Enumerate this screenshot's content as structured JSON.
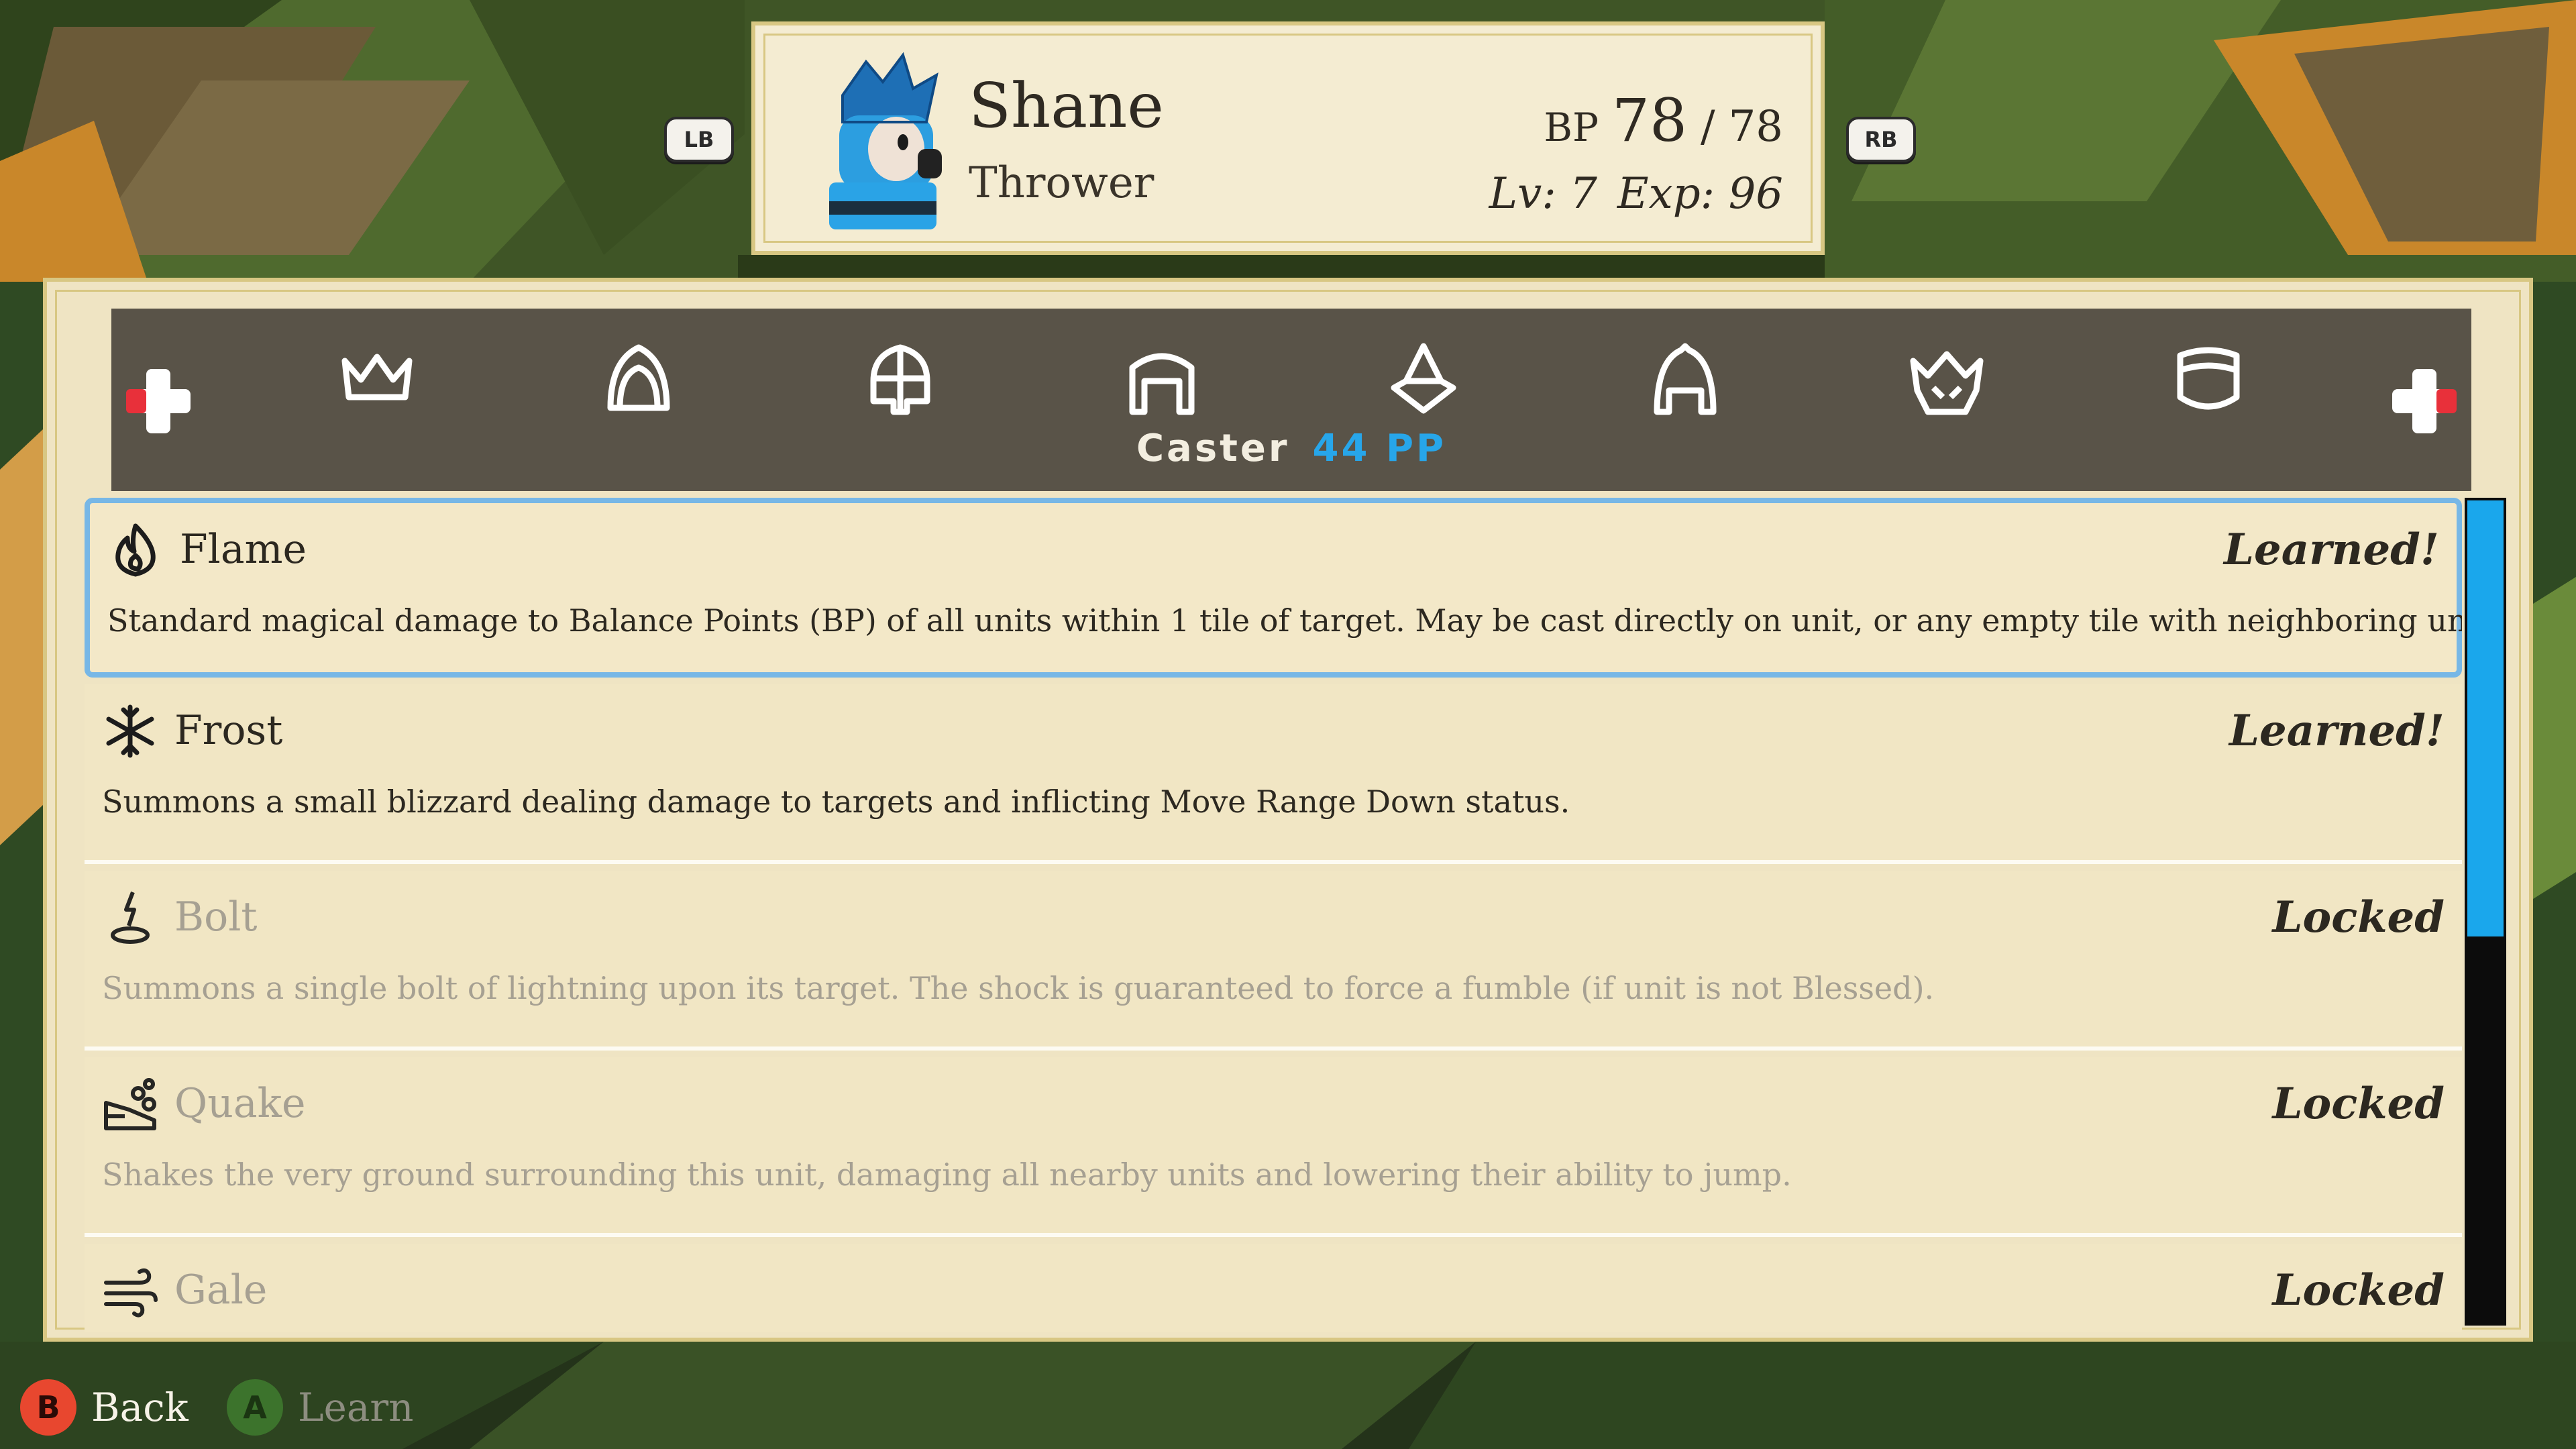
{
  "colors": {
    "accent_blue": "#1aa7ec",
    "panel": "#efe4c3",
    "border_gold": "#d8c783",
    "tabbar": "#595348",
    "b_button": "#e8472f",
    "a_button": "#4a9a37"
  },
  "unit": {
    "name": "Shane",
    "class": "Thrower",
    "bp_label": "BP",
    "bp_current": "78",
    "bp_separator": "/",
    "bp_max": "78",
    "level": "Lv: 7",
    "exp": "Exp: 96"
  },
  "bumpers": {
    "left": "LB",
    "right": "RB"
  },
  "tabs": {
    "icons": [
      "crown-icon",
      "hood-icon",
      "knight-helm-icon",
      "arch-helm-icon",
      "wizard-hat-icon",
      "cap-helm-icon",
      "horned-helm-icon",
      "bucket-helm-icon"
    ],
    "selected_class": "Caster",
    "pp": "44 PP"
  },
  "skills": [
    {
      "icon": "flame-icon",
      "name": "Flame",
      "status": "Learned!",
      "state": "learned",
      "selected": true,
      "description": "Standard magical damage to Balance Points (BP) of all units within 1 tile of target. May be cast directly on unit, or any empty tile with neighboring units."
    },
    {
      "icon": "snowflake-icon",
      "name": "Frost",
      "status": "Learned!",
      "state": "learned",
      "selected": false,
      "description": "Summons a small blizzard dealing damage to targets and inflicting Move Range Down status."
    },
    {
      "icon": "bolt-icon",
      "name": "Bolt",
      "status": "Locked",
      "state": "locked",
      "selected": false,
      "description": "Summons a single bolt of lightning upon its target. The shock is guaranteed to force a fumble (if unit is not Blessed)."
    },
    {
      "icon": "quake-icon",
      "name": "Quake",
      "status": "Locked",
      "state": "locked",
      "selected": false,
      "description": "Shakes the very ground surrounding this unit, damaging all nearby units and lowering their ability to jump."
    },
    {
      "icon": "gale-icon",
      "name": "Gale",
      "status": "Locked",
      "state": "locked",
      "selected": false,
      "description": ""
    }
  ],
  "scroll": {
    "thumb_fraction": 0.53
  },
  "prompts": {
    "back": {
      "button": "B",
      "label": "Back"
    },
    "learn": {
      "button": "A",
      "label": "Learn"
    }
  }
}
